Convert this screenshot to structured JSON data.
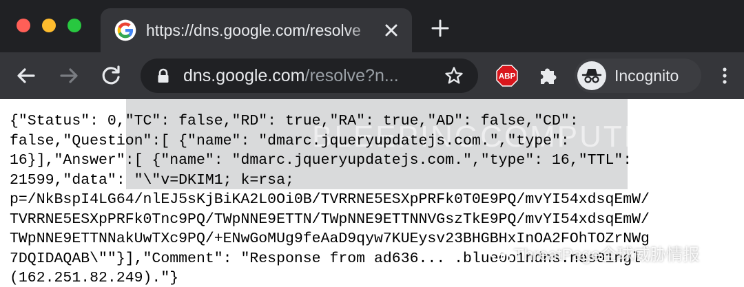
{
  "window": {
    "controls": [
      "close",
      "minimize",
      "zoom"
    ]
  },
  "tab": {
    "title": "https://dns.google.com/resolve",
    "favicon": "google-g-icon",
    "close_icon": "close-icon"
  },
  "new_tab_icon": "plus-icon",
  "toolbar": {
    "back_icon": "arrow-left-icon",
    "forward_icon": "arrow-right-icon",
    "reload_icon": "reload-icon",
    "url_host": "dns.google.com",
    "url_path": "/resolve?n...",
    "bookmark_icon": "star-icon",
    "extensions": [
      {
        "name": "adblock-plus",
        "label": "ABP"
      },
      {
        "name": "puzzle-icon"
      }
    ],
    "incognito_label": "Incognito",
    "menu_icon": "vertical-dots-icon"
  },
  "content": {
    "json_lines": [
      "{\"Status\": 0,\"TC\": false,\"RD\": true,\"RA\": true,\"AD\": false,\"CD\":",
      "false,\"Question\":[ {\"name\": \"dmarc.jqueryupdatejs.com.\",\"type\":",
      "16}],\"Answer\":[ {\"name\": \"dmarc.jqueryupdatejs.com.\",\"type\": 16,\"TTL\":",
      "21599,\"data\": \"\\\"v=DKIM1; k=rsa;",
      "p=/NkBspI4LG64/nlEJ5sKjBiKA2L0Oi0B/TVRRNE5ESXpPRFk0T0E9PQ/mvYI54xdsqEmW/",
      "TVRRNE5ESXpPRFk0Tnc9PQ/TWpNNE9ETTN/TWpNNE9ETTNNVGszTkE9PQ/mvYI54xdsqEmW/",
      "TWpNNE9ETTNNakUwTXc9PQ/+ENwGoMUg9feAaD9qyw7KUEysv23BHGBHxInOA2FOhTOZrNWg",
      "7DQIDAQAB\\\"\"}],\"Comment\": \"Response from ad636... .blue0o1ndns.nes01ngl",
      "(162.251.82.249).\"}"
    ],
    "watermark": "BLEEPINGCOMPUTER",
    "overlay_watermark": "ThreatPage全球威胁情报"
  },
  "colors": {
    "tabstrip": "#202124",
    "toolbar": "#35363a",
    "text_light": "#e8eaed",
    "abp_red": "#d9161c"
  }
}
